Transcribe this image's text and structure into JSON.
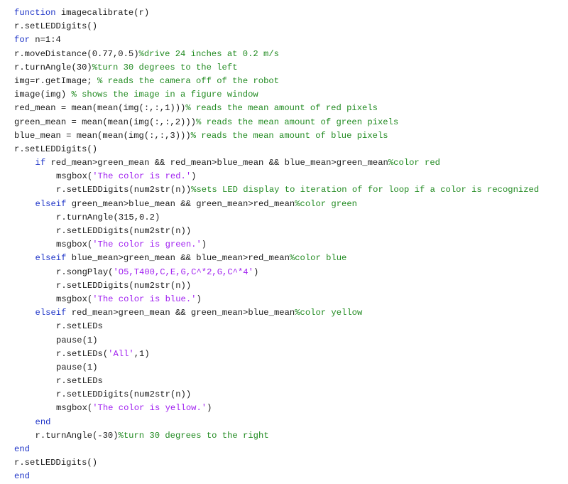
{
  "editor": {
    "language": "matlab",
    "colors": {
      "keyword": "#1f35c8",
      "comment": "#228b22",
      "string": "#a020f0",
      "text": "#1a1a1a"
    },
    "lines": [
      {
        "indent": 0,
        "tokens": [
          {
            "t": "kw",
            "v": "function"
          },
          {
            "t": "pl",
            "v": " imagecalibrate(r)"
          }
        ]
      },
      {
        "indent": 0,
        "tokens": [
          {
            "t": "pl",
            "v": "r.setLEDDigits()"
          }
        ]
      },
      {
        "indent": 0,
        "tokens": [
          {
            "t": "kw",
            "v": "for"
          },
          {
            "t": "pl",
            "v": " n=1:4"
          }
        ]
      },
      {
        "indent": 0,
        "tokens": [
          {
            "t": "pl",
            "v": "r.moveDistance(0.77,0.5)"
          },
          {
            "t": "cm",
            "v": "%drive 24 inches at 0.2 m/s"
          }
        ]
      },
      {
        "indent": 0,
        "tokens": [
          {
            "t": "pl",
            "v": "r.turnAngle(30)"
          },
          {
            "t": "cm",
            "v": "%turn 30 degrees to the left"
          }
        ]
      },
      {
        "indent": 0,
        "tokens": [
          {
            "t": "pl",
            "v": "img=r.getImage; "
          },
          {
            "t": "cm",
            "v": "% reads the camera off of the robot"
          }
        ]
      },
      {
        "indent": 0,
        "tokens": [
          {
            "t": "pl",
            "v": "image(img) "
          },
          {
            "t": "cm",
            "v": "% shows the image in a figure window"
          }
        ]
      },
      {
        "indent": 0,
        "tokens": [
          {
            "t": "pl",
            "v": "red_mean = mean(mean(img(:,:,1)))"
          },
          {
            "t": "cm",
            "v": "% reads the mean amount of red pixels"
          }
        ]
      },
      {
        "indent": 0,
        "tokens": [
          {
            "t": "pl",
            "v": "green_mean = mean(mean(img(:,:,2)))"
          },
          {
            "t": "cm",
            "v": "% reads the mean amount of green pixels"
          }
        ]
      },
      {
        "indent": 0,
        "tokens": [
          {
            "t": "pl",
            "v": "blue_mean = mean(mean(img(:,:,3)))"
          },
          {
            "t": "cm",
            "v": "% reads the mean amount of blue pixels"
          }
        ]
      },
      {
        "indent": 0,
        "tokens": [
          {
            "t": "pl",
            "v": "r.setLEDDigits()"
          }
        ]
      },
      {
        "indent": 1,
        "tokens": [
          {
            "t": "kw",
            "v": "if"
          },
          {
            "t": "pl",
            "v": " red_mean>green_mean && red_mean>blue_mean && blue_mean>green_mean"
          },
          {
            "t": "cm",
            "v": "%color red"
          }
        ]
      },
      {
        "indent": 2,
        "tokens": [
          {
            "t": "pl",
            "v": "msgbox("
          },
          {
            "t": "st",
            "v": "'The color is red.'"
          },
          {
            "t": "pl",
            "v": ")"
          }
        ]
      },
      {
        "indent": 2,
        "tokens": [
          {
            "t": "pl",
            "v": "r.setLEDDigits(num2str(n))"
          },
          {
            "t": "cm",
            "v": "%sets LED display to iteration of for loop if a color is recognized"
          }
        ]
      },
      {
        "indent": 1,
        "tokens": [
          {
            "t": "kw",
            "v": "elseif"
          },
          {
            "t": "pl",
            "v": " green_mean>blue_mean && green_mean>red_mean"
          },
          {
            "t": "cm",
            "v": "%color green"
          }
        ]
      },
      {
        "indent": 2,
        "tokens": [
          {
            "t": "pl",
            "v": "r.turnAngle(315,0.2)"
          }
        ]
      },
      {
        "indent": 2,
        "tokens": [
          {
            "t": "pl",
            "v": "r.setLEDDigits(num2str(n))"
          }
        ]
      },
      {
        "indent": 2,
        "tokens": [
          {
            "t": "pl",
            "v": "msgbox("
          },
          {
            "t": "st",
            "v": "'The color is green.'"
          },
          {
            "t": "pl",
            "v": ")"
          }
        ]
      },
      {
        "indent": 1,
        "tokens": [
          {
            "t": "kw",
            "v": "elseif"
          },
          {
            "t": "pl",
            "v": " blue_mean>green_mean && blue_mean>red_mean"
          },
          {
            "t": "cm",
            "v": "%color blue"
          }
        ]
      },
      {
        "indent": 2,
        "tokens": [
          {
            "t": "pl",
            "v": "r.songPlay("
          },
          {
            "t": "st",
            "v": "'O5,T400,C,E,G,C^*2,G,C^*4'"
          },
          {
            "t": "pl",
            "v": ")"
          }
        ]
      },
      {
        "indent": 2,
        "tokens": [
          {
            "t": "pl",
            "v": "r.setLEDDigits(num2str(n))"
          }
        ]
      },
      {
        "indent": 2,
        "tokens": [
          {
            "t": "pl",
            "v": "msgbox("
          },
          {
            "t": "st",
            "v": "'The color is blue.'"
          },
          {
            "t": "pl",
            "v": ")"
          }
        ]
      },
      {
        "indent": 1,
        "tokens": [
          {
            "t": "kw",
            "v": "elseif"
          },
          {
            "t": "pl",
            "v": " red_mean>green_mean && green_mean>blue_mean"
          },
          {
            "t": "cm",
            "v": "%color yellow"
          }
        ]
      },
      {
        "indent": 2,
        "tokens": [
          {
            "t": "pl",
            "v": "r.setLEDs"
          }
        ]
      },
      {
        "indent": 2,
        "tokens": [
          {
            "t": "pl",
            "v": "pause(1)"
          }
        ]
      },
      {
        "indent": 2,
        "tokens": [
          {
            "t": "pl",
            "v": "r.setLEDs("
          },
          {
            "t": "st",
            "v": "'All'"
          },
          {
            "t": "pl",
            "v": ",1)"
          }
        ]
      },
      {
        "indent": 2,
        "tokens": [
          {
            "t": "pl",
            "v": "pause(1)"
          }
        ]
      },
      {
        "indent": 2,
        "tokens": [
          {
            "t": "pl",
            "v": "r.setLEDs"
          }
        ]
      },
      {
        "indent": 2,
        "tokens": [
          {
            "t": "pl",
            "v": "r.setLEDDigits(num2str(n))"
          }
        ]
      },
      {
        "indent": 2,
        "tokens": [
          {
            "t": "pl",
            "v": "msgbox("
          },
          {
            "t": "st",
            "v": "'The color is yellow.'"
          },
          {
            "t": "pl",
            "v": ")"
          }
        ]
      },
      {
        "indent": 1,
        "tokens": [
          {
            "t": "kw",
            "v": "end"
          }
        ]
      },
      {
        "indent": 1,
        "tokens": [
          {
            "t": "pl",
            "v": "r.turnAngle(-30)"
          },
          {
            "t": "cm",
            "v": "%turn 30 degrees to the right"
          }
        ]
      },
      {
        "indent": 0,
        "tokens": [
          {
            "t": "kw",
            "v": "end"
          }
        ]
      },
      {
        "indent": 0,
        "tokens": [
          {
            "t": "pl",
            "v": "r.setLEDDigits()"
          }
        ]
      },
      {
        "indent": 0,
        "tokens": [
          {
            "t": "kw",
            "v": "end"
          }
        ]
      }
    ]
  }
}
